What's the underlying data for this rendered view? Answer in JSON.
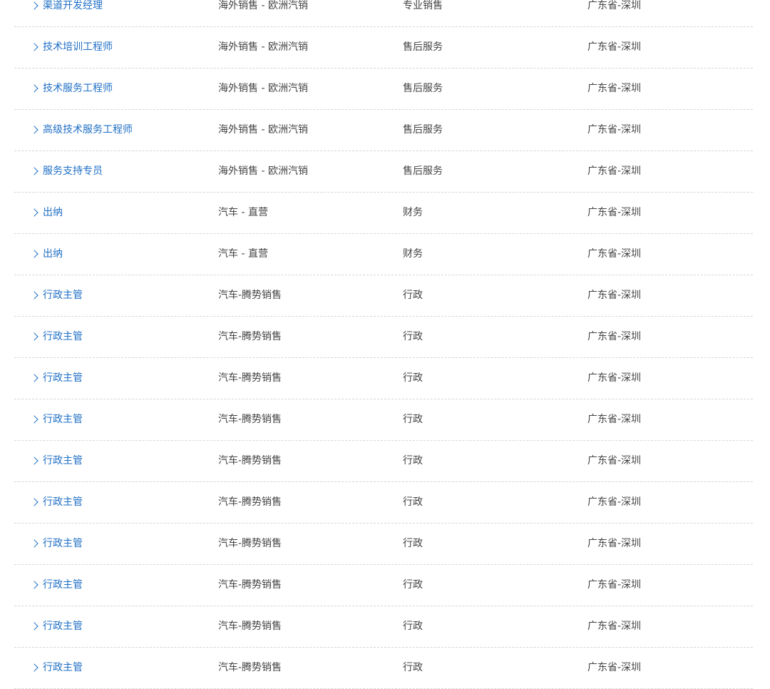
{
  "colors": {
    "link": "#1f6fc5",
    "text": "#444444",
    "divider": "#d6d6d6"
  },
  "icons": {
    "row_expand": "chevron-right-icon"
  },
  "jobs": [
    {
      "title": "渠道开发经理",
      "department": "海外销售 - 欧洲汽销",
      "category": "专业销售",
      "location": "广东省-深圳"
    },
    {
      "title": "技术培训工程师",
      "department": "海外销售 - 欧洲汽销",
      "category": "售后服务",
      "location": "广东省-深圳"
    },
    {
      "title": "技术服务工程师",
      "department": "海外销售 - 欧洲汽销",
      "category": "售后服务",
      "location": "广东省-深圳"
    },
    {
      "title": "高级技术服务工程师",
      "department": "海外销售 - 欧洲汽销",
      "category": "售后服务",
      "location": "广东省-深圳"
    },
    {
      "title": "服务支持专员",
      "department": "海外销售 - 欧洲汽销",
      "category": "售后服务",
      "location": "广东省-深圳"
    },
    {
      "title": "出纳",
      "department": "汽车 - 直营",
      "category": "财务",
      "location": "广东省-深圳"
    },
    {
      "title": "出纳",
      "department": "汽车 - 直营",
      "category": "财务",
      "location": "广东省-深圳"
    },
    {
      "title": "行政主管",
      "department": "汽车-腾势销售",
      "category": "行政",
      "location": "广东省-深圳"
    },
    {
      "title": "行政主管",
      "department": "汽车-腾势销售",
      "category": "行政",
      "location": "广东省-深圳"
    },
    {
      "title": "行政主管",
      "department": "汽车-腾势销售",
      "category": "行政",
      "location": "广东省-深圳"
    },
    {
      "title": "行政主管",
      "department": "汽车-腾势销售",
      "category": "行政",
      "location": "广东省-深圳"
    },
    {
      "title": "行政主管",
      "department": "汽车-腾势销售",
      "category": "行政",
      "location": "广东省-深圳"
    },
    {
      "title": "行政主管",
      "department": "汽车-腾势销售",
      "category": "行政",
      "location": "广东省-深圳"
    },
    {
      "title": "行政主管",
      "department": "汽车-腾势销售",
      "category": "行政",
      "location": "广东省-深圳"
    },
    {
      "title": "行政主管",
      "department": "汽车-腾势销售",
      "category": "行政",
      "location": "广东省-深圳"
    },
    {
      "title": "行政主管",
      "department": "汽车-腾势销售",
      "category": "行政",
      "location": "广东省-深圳"
    },
    {
      "title": "行政主管",
      "department": "汽车-腾势销售",
      "category": "行政",
      "location": "广东省-深圳"
    }
  ]
}
